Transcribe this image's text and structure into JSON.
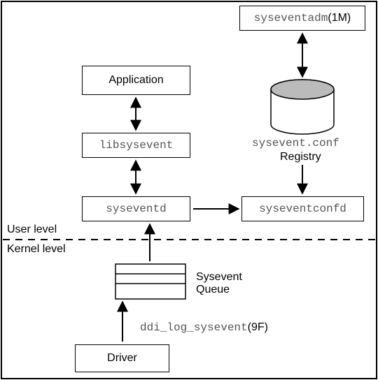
{
  "nodes": {
    "syseventadm": {
      "cmd": "syseventadm",
      "man": "(1M)"
    },
    "application": "Application",
    "libsysevent": "libsysevent",
    "syseventd": "syseventd",
    "syseventconfd": "syseventconfd",
    "driver": "Driver"
  },
  "cylinder": {
    "file": "sysevent.conf",
    "caption": "Registry"
  },
  "queue": {
    "l1": "Sysevent",
    "l2": "Queue"
  },
  "labels": {
    "user": "User level",
    "kernel": "Kernel level",
    "ddi_cmd": "ddi_log_sysevent",
    "ddi_man": "(9F)"
  }
}
